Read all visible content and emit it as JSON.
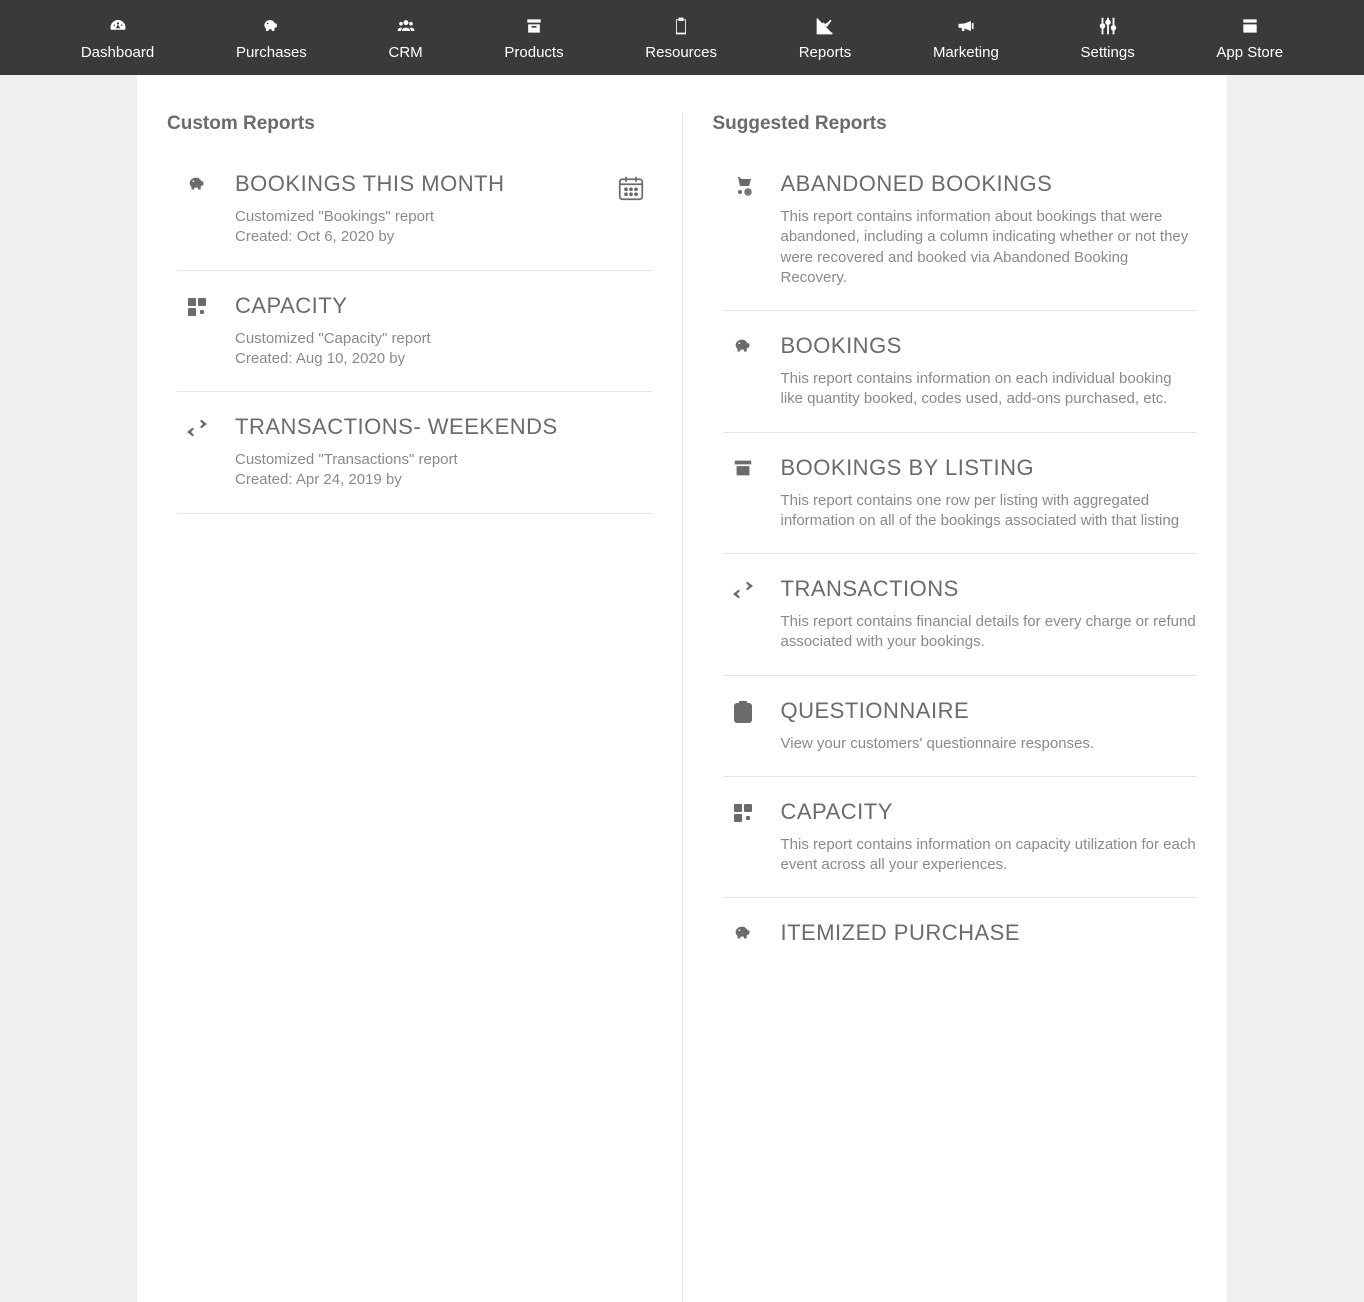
{
  "nav": {
    "items": [
      {
        "label": "Dashboard"
      },
      {
        "label": "Purchases"
      },
      {
        "label": "CRM"
      },
      {
        "label": "Products"
      },
      {
        "label": "Resources"
      },
      {
        "label": "Reports"
      },
      {
        "label": "Marketing"
      },
      {
        "label": "Settings"
      },
      {
        "label": "App Store"
      }
    ]
  },
  "custom": {
    "heading": "Custom Reports",
    "items": [
      {
        "title": "BOOKINGS THIS MONTH",
        "desc": "Customized \"Bookings\" report",
        "meta": "Created: Oct 6, 2020 by"
      },
      {
        "title": "CAPACITY",
        "desc": "Customized \"Capacity\" report",
        "meta": "Created: Aug 10, 2020 by"
      },
      {
        "title": "TRANSACTIONS- WEEKENDS",
        "desc": "Customized \"Transactions\" report",
        "meta": "Created: Apr 24, 2019 by"
      }
    ]
  },
  "suggested": {
    "heading": "Suggested Reports",
    "items": [
      {
        "title": "ABANDONED BOOKINGS",
        "desc": "This report contains information about bookings that were abandoned, including a column indicating whether or not they were recovered and booked via Abandoned Booking Recovery."
      },
      {
        "title": "BOOKINGS",
        "desc": "This report contains information on each individual booking like quantity booked, codes used, add-ons purchased, etc."
      },
      {
        "title": "BOOKINGS BY LISTING",
        "desc": "This report contains one row per listing with aggregated information on all of the bookings associated with that listing"
      },
      {
        "title": "TRANSACTIONS",
        "desc": "This report contains financial details for every charge or refund associated with your bookings."
      },
      {
        "title": "QUESTIONNAIRE",
        "desc": "View your customers' questionnaire responses."
      },
      {
        "title": "CAPACITY",
        "desc": "This report contains information on capacity utilization for each event across all your experiences."
      },
      {
        "title": "ITEMIZED PURCHASE",
        "desc": ""
      }
    ]
  }
}
